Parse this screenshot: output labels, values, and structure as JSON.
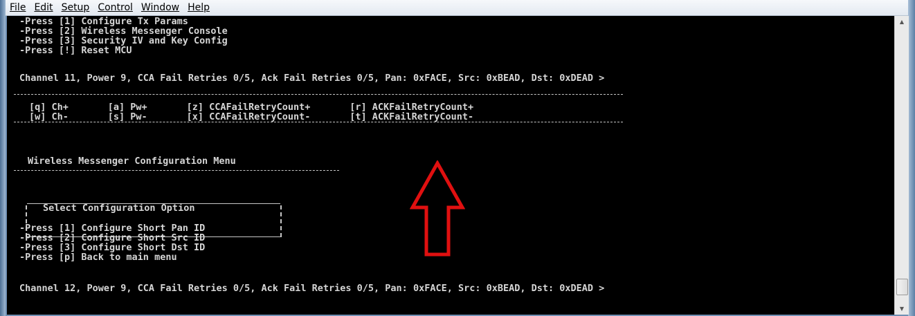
{
  "menu": [
    "File",
    "Edit",
    "Setup",
    "Control",
    "Window",
    "Help"
  ],
  "console": {
    "main_menu": [
      "-Press [1] Configure Tx Params",
      "-Press [2] Wireless Messenger Console",
      "-Press [3] Security IV and Key Config",
      "-Press [!] Reset MCU"
    ],
    "status_1": "Channel 11, Power 9, CCA Fail Retries 0/5, Ack Fail Retries 0/5, Pan: 0xFACE, Src: 0xBEAD, Dst: 0xDEAD >",
    "keys_row_1": "[q] Ch+       [a] Pw+       [z] CCAFailRetryCount+       [r] ACKFailRetryCount+",
    "keys_row_2": "[w] Ch-       [s] Pw-       [x] CCAFailRetryCount-       [t] ACKFailRetryCount-",
    "wm_title": "Wireless Messenger Configuration Menu",
    "select_title": "Select Configuration Option",
    "wm_options": [
      "-Press [1] Configure Short Pan ID",
      "-Press [2] Configure Short Src ID",
      "-Press [3] Configure Short Dst ID",
      "-Press [p] Back to main menu"
    ],
    "status_2": "Channel 12, Power 9, CCA Fail Retries 0/5, Ack Fail Retries 0/5, Pan: 0xFACE, Src: 0xBEAD, Dst: 0xDEAD >"
  },
  "colors": {
    "console_bg": "#000000",
    "console_text": "#d6d6d6",
    "annotation_arrow": "#e01010"
  },
  "icons": [
    "scroll-up-icon",
    "scroll-down-icon",
    "red-up-arrow-icon"
  ]
}
